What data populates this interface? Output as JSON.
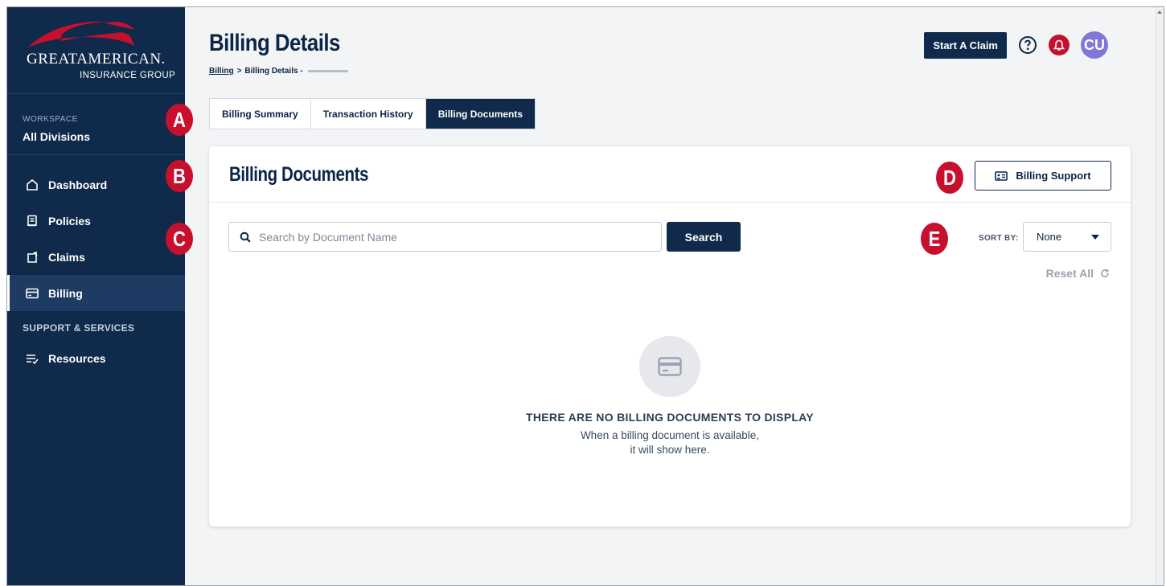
{
  "brand": {
    "name_line1": "GREATAMERICAN.",
    "name_line2": "INSURANCE GROUP"
  },
  "sidebar": {
    "workspace_label": "WORKSPACE",
    "workspace_value": "All Divisions",
    "items": [
      {
        "label": "Dashboard",
        "icon": "home-icon"
      },
      {
        "label": "Policies",
        "icon": "policy-icon"
      },
      {
        "label": "Claims",
        "icon": "claims-icon"
      },
      {
        "label": "Billing",
        "icon": "credit-card-icon",
        "active": true
      }
    ],
    "section_label": "SUPPORT & SERVICES",
    "support_items": [
      {
        "label": "Resources",
        "icon": "list-check-icon"
      }
    ]
  },
  "header": {
    "title": "Billing Details",
    "breadcrumb": {
      "link": "Billing",
      "separator": ">",
      "current": "Billing Details -"
    },
    "start_claim_label": "Start A Claim",
    "avatar_initials": "CU"
  },
  "tabs": [
    {
      "label": "Billing Summary",
      "active": false
    },
    {
      "label": "Transaction History",
      "active": false
    },
    {
      "label": "Billing Documents",
      "active": true
    }
  ],
  "card": {
    "title": "Billing Documents",
    "support_button_label": "Billing Support",
    "search": {
      "placeholder": "Search by Document Name",
      "value": "",
      "button_label": "Search"
    },
    "sort": {
      "label": "SORT BY:",
      "selected": "None"
    },
    "reset_label": "Reset All",
    "empty": {
      "title": "THERE ARE NO BILLING DOCUMENTS TO DISPLAY",
      "desc_line1": "When a billing document is available,",
      "desc_line2": "it will show here."
    }
  },
  "callouts": [
    "A",
    "B",
    "C",
    "D",
    "E"
  ],
  "colors": {
    "navy": "#0f2a4a",
    "red": "#c8102e",
    "avatar": "#7f77d9"
  }
}
